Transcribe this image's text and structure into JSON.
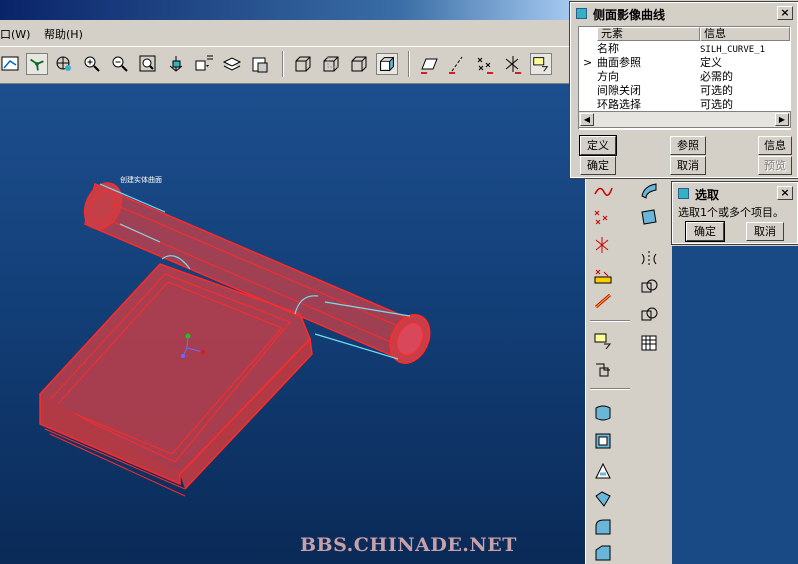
{
  "menu": {
    "items": [
      "窗口(W)",
      "帮助(H)"
    ],
    "visible_fragment": "口(W)",
    "help": "帮助(H)"
  },
  "viewport": {
    "model_label": "创建实体曲面",
    "watermark": "BBS.CHINADE.NET"
  },
  "dialog_main": {
    "title": "侧面影像曲线",
    "columns": {
      "element": "元素",
      "info": "信息"
    },
    "rows": [
      {
        "element": "名称",
        "info": "SILH_CURVE_1",
        "current": false
      },
      {
        "element": "曲面参照",
        "info": "定义",
        "current": true
      },
      {
        "element": "方向",
        "info": "必需的",
        "current": false
      },
      {
        "element": "间隙关闭",
        "info": "可选的",
        "current": false
      },
      {
        "element": "环路选择",
        "info": "可选的",
        "current": false
      }
    ],
    "current_marker": ">",
    "buttons": {
      "define": "定义",
      "refs": "参照",
      "info": "信息",
      "ok": "确定",
      "cancel": "取消",
      "preview": "预览"
    },
    "close": "×"
  },
  "dialog_select": {
    "title": "选取",
    "prompt": "选取1个或多个项目。",
    "buttons": {
      "ok": "确定",
      "cancel": "取消"
    },
    "close": "×"
  },
  "scroll": {
    "left": "◀",
    "right": "▶"
  },
  "colors": {
    "model": "#ff2a2a",
    "model_fill": "#c2404a",
    "edge": "#70e0f0",
    "accent": "#35b1c6"
  },
  "icons": [
    "sketch-icon",
    "datum-axis-icon",
    "spin-center-icon",
    "zoom-in-icon",
    "zoom-out-icon",
    "refit-icon",
    "orient-icon",
    "saved-views-icon",
    "layers-icon",
    "model-tree-icon",
    "wireframe-icon",
    "hidden-line-icon",
    "no-hidden-icon",
    "shaded-icon",
    "datum-plane-icon",
    "datum-axis-display-icon",
    "datum-point-icon",
    "coordsys-icon",
    "annotation-icon"
  ]
}
